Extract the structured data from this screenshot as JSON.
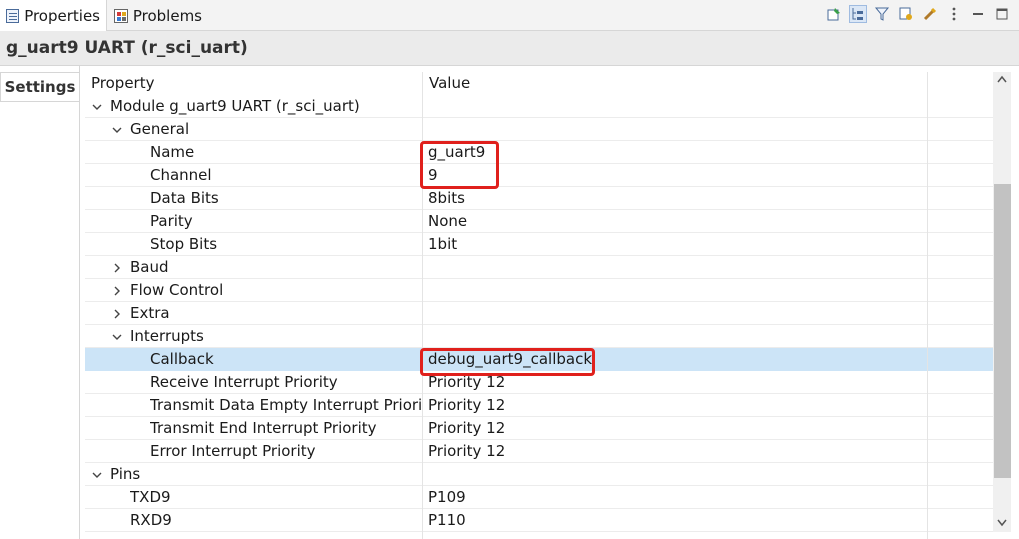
{
  "tabs": [
    {
      "label": "Properties",
      "icon": "properties-icon",
      "active": true
    },
    {
      "label": "Problems",
      "icon": "problems-icon",
      "active": false
    }
  ],
  "toolbar_icons": [
    "pin-icon",
    "show-categories-icon",
    "filter-icon",
    "advanced-icon",
    "restore-default-icon",
    "view-menu-icon",
    "minimize-icon",
    "maximize-icon"
  ],
  "title": "g_uart9 UART (r_sci_uart)",
  "side_tab": "Settings",
  "table": {
    "headers": [
      "Property",
      "Value"
    ],
    "rows": [
      {
        "level": 0,
        "expander": "expanded",
        "property": "Module g_uart9 UART (r_sci_uart)",
        "value": ""
      },
      {
        "level": 1,
        "expander": "expanded",
        "property": "General",
        "value": ""
      },
      {
        "level": 2,
        "expander": "none",
        "property": "Name",
        "value": "g_uart9"
      },
      {
        "level": 2,
        "expander": "none",
        "property": "Channel",
        "value": "9"
      },
      {
        "level": 2,
        "expander": "none",
        "property": "Data Bits",
        "value": "8bits"
      },
      {
        "level": 2,
        "expander": "none",
        "property": "Parity",
        "value": "None"
      },
      {
        "level": 2,
        "expander": "none",
        "property": "Stop Bits",
        "value": "1bit"
      },
      {
        "level": 1,
        "expander": "collapsed",
        "property": "Baud",
        "value": ""
      },
      {
        "level": 1,
        "expander": "collapsed",
        "property": "Flow Control",
        "value": ""
      },
      {
        "level": 1,
        "expander": "collapsed",
        "property": "Extra",
        "value": ""
      },
      {
        "level": 1,
        "expander": "expanded",
        "property": "Interrupts",
        "value": ""
      },
      {
        "level": 2,
        "expander": "none",
        "property": "Callback",
        "value": "debug_uart9_callback",
        "selected": true
      },
      {
        "level": 2,
        "expander": "none",
        "property": "Receive Interrupt Priority",
        "value": "Priority 12"
      },
      {
        "level": 2,
        "expander": "none",
        "property": "Transmit Data Empty Interrupt Priority",
        "value": "Priority 12"
      },
      {
        "level": 2,
        "expander": "none",
        "property": "Transmit End Interrupt Priority",
        "value": "Priority 12"
      },
      {
        "level": 2,
        "expander": "none",
        "property": "Error Interrupt Priority",
        "value": "Priority 12"
      },
      {
        "level": 0,
        "expander": "expanded",
        "property": "Pins",
        "value": ""
      },
      {
        "level": 1,
        "expander": "none",
        "property": "TXD9",
        "value": "P109"
      },
      {
        "level": 1,
        "expander": "none",
        "property": "RXD9",
        "value": "P110"
      }
    ]
  },
  "colors": {
    "selection": "#cce4f7",
    "highlight_box": "#e0201c"
  }
}
